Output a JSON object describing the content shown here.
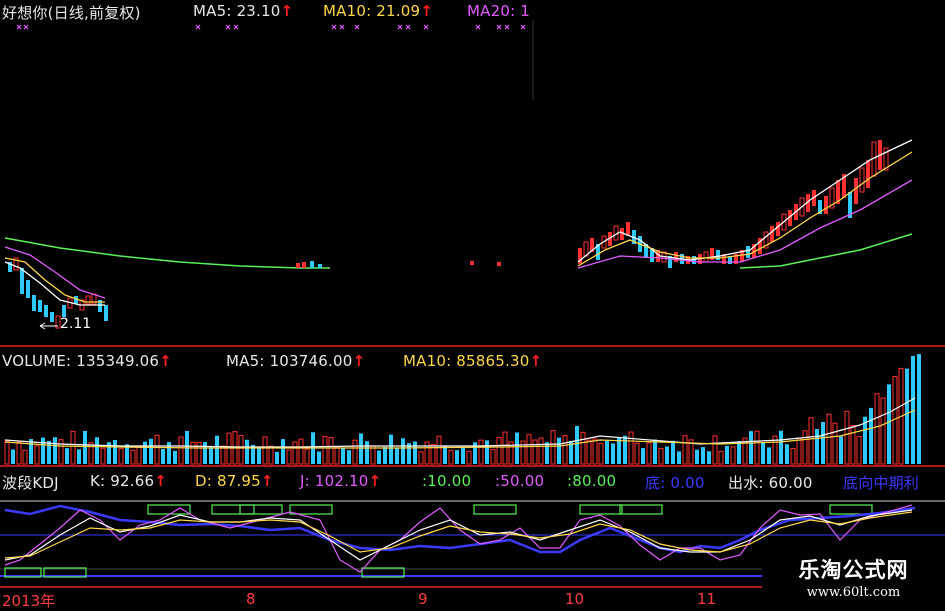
{
  "price_panel": {
    "name": "好想你(日线,前复权)",
    "ma5_label": "MA5: 23.10",
    "ma10_label": "MA10: 21.09",
    "ma20_label": "MA20: 1",
    "arrow": "↑",
    "low_marker": "2.11"
  },
  "volume_panel": {
    "volume_label": "VOLUME: 135349.06",
    "ma5_label": "MA5: 103746.00",
    "ma10_label": "MA10: 85865.30",
    "arrow": "↑"
  },
  "kdj_panel": {
    "name": "波段KDJ",
    "k_label": "K: 92.66",
    "d_label": "D: 87.95",
    "j_label": "J: 102.10",
    "level1": ":10.00",
    "level2": ":50.00",
    "level3": ":80.00",
    "bottom_label": "底: 0.00",
    "exit_label": "出水: 60.00",
    "trend_label": "底向中期利",
    "arrow": "↑"
  },
  "date_axis": {
    "labels": [
      "2013年",
      "8",
      "9",
      "10",
      "11"
    ]
  },
  "watermark": {
    "title": "乐淘公式网",
    "url": "www.60lt.com"
  },
  "colors": {
    "background": "#000000",
    "rise": "#ff3030",
    "fall": "#2fc9ff",
    "ma5": "#ffffff",
    "ma10": "#ffd84a",
    "ma20": "#e15cff",
    "ma60": "#5af05a",
    "panel_border": "#b01818"
  }
}
